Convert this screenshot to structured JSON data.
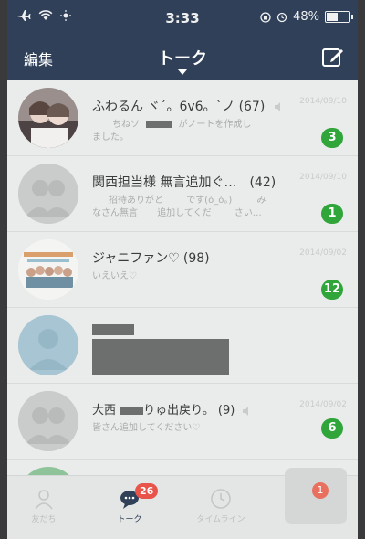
{
  "status": {
    "time": "3:33",
    "battery": "48%",
    "battery_level": 0.48
  },
  "nav": {
    "edit_label": "編集",
    "title": "トーク"
  },
  "chats": [
    {
      "name": "ふわるん ヾ´。6v6。`ノ",
      "count": "(67)",
      "preview_a": "ちねソ",
      "preview_b": "がノートを作成し",
      "preview_c": "ました。",
      "date": "2014/09/10",
      "badge": "3"
    },
    {
      "name": "関西担当様 無言追加ぐ…",
      "count": "(42)",
      "preview_a": "招待ありがと",
      "preview_b": "です(ó_ò。)",
      "preview_c": "み",
      "preview_d": "なさん無言",
      "preview_e": "追加してくだ",
      "preview_f": "さい…",
      "date": "2014/09/10",
      "badge": "1"
    },
    {
      "name": "ジャニファン♡",
      "count": "(98)",
      "preview_a": "いえいえ♡",
      "date": "2014/09/02",
      "badge": "12"
    },
    {
      "name": "",
      "count": "",
      "date": "",
      "badge": ""
    },
    {
      "name_a": "大西",
      "name_b": "りゅ出戻り。",
      "count": "(9)",
      "preview_a": "皆さん追加してください♡",
      "date": "2014/09/02",
      "badge": "6"
    }
  ],
  "tabs": [
    {
      "label": "友だち"
    },
    {
      "label": "トーク",
      "badge": "26"
    },
    {
      "label": "タイムライン"
    }
  ],
  "floating": {
    "badge": "1"
  },
  "colors": {
    "header": "#2f4058",
    "badge_green": "#2fa53a",
    "tab_badge_red": "#e8534a"
  }
}
